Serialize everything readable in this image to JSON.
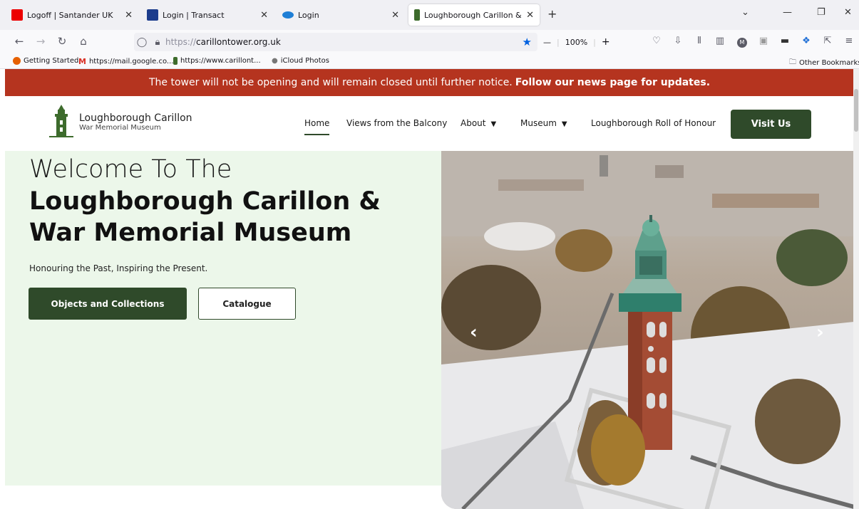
{
  "browser": {
    "tabs": [
      {
        "label": "Logoff | Santander UK",
        "fav_color": "#ec0000"
      },
      {
        "label": "Login | Transact",
        "fav_color": "#1c3c8c"
      },
      {
        "label": "Login",
        "fav_color": "#1f7fd6"
      },
      {
        "label": "Loughborough Carillon & War",
        "fav_color": "#3d6b2c"
      }
    ],
    "url_scheme": "https://",
    "url_host": "carillontower.org.uk",
    "zoom": "100%",
    "bookmarks": [
      {
        "label": "Getting Started",
        "color": "#e66000"
      },
      {
        "label": "https://mail.google.co...",
        "color": "#d93025"
      },
      {
        "label": "https://www.carillont...",
        "color": "#3d6b2c"
      },
      {
        "label": "iCloud Photos",
        "color": "#888888"
      }
    ],
    "other_bookmarks": "Other Bookmarks"
  },
  "site": {
    "banner_text": "The tower will not be opening and will remain closed until further notice.",
    "banner_link": "Follow our news page for updates.",
    "logo_title": "Loughborough Carillon",
    "logo_subtitle": "War Memorial Museum",
    "nav": {
      "home": "Home",
      "views": "Views from the Balcony",
      "about": "About",
      "museum": "Museum",
      "roll": "Loughborough Roll of Honour"
    },
    "visit_label": "Visit Us",
    "hero": {
      "welcome": "Welcome To The",
      "title": "Loughborough Carillon & War Memorial Museum",
      "subtitle": "Honouring the Past, Inspiring the Present.",
      "button_primary": "Objects and Collections",
      "button_secondary": "Catalogue"
    }
  },
  "colors": {
    "brand_green": "#2f4a2a",
    "banner_red": "#b5341f",
    "hero_bg": "#ecf7ea"
  }
}
